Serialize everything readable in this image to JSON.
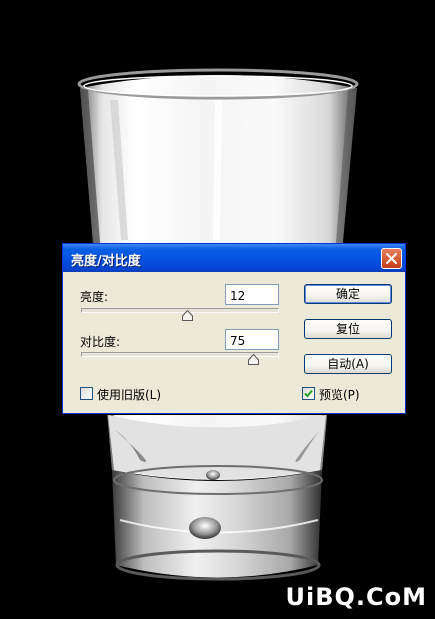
{
  "dialog": {
    "title": "亮度/对比度",
    "brightness": {
      "label": "亮度:",
      "value": "12"
    },
    "contrast": {
      "label": "对比度:",
      "value": "75"
    },
    "buttons": {
      "ok": "确定",
      "reset": "复位",
      "auto": "自动(A)"
    },
    "legacy": {
      "label": "使用旧版(L)",
      "checked": false
    },
    "preview": {
      "label": "预览(P)",
      "checked": true
    }
  },
  "watermark": "UiBQ.CoM",
  "colors": {
    "titlebar": "#0554e3",
    "dialog_bg": "#ece9d8",
    "close": "#c43d18",
    "background": "#000000"
  }
}
